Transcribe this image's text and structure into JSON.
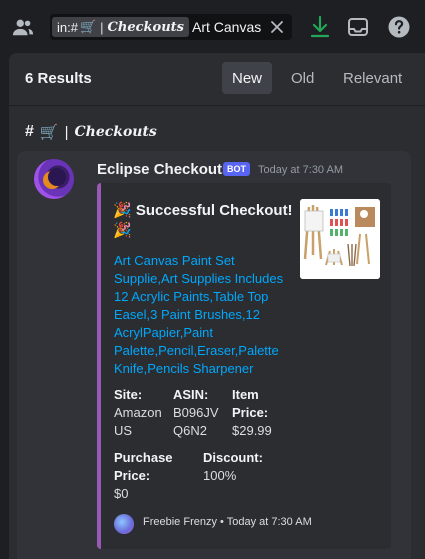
{
  "topbar": {
    "people_icon": "people-icon",
    "search": {
      "chip_prefix": "in:",
      "chip_hash": "#",
      "chip_emoji": "🛒",
      "chip_sep": "|",
      "chip_channel": "𝑪𝒉𝒆𝒄𝒌𝒐𝒖𝒕𝒔",
      "query": "Art Canvas",
      "clear_icon": "close-icon"
    },
    "download_icon": "download-icon",
    "inbox_icon": "inbox-icon",
    "help_icon": "help-icon",
    "download_color": "#23a55a"
  },
  "results": {
    "count": "6 Results",
    "sort_tabs": [
      {
        "label": "New",
        "active": true
      },
      {
        "label": "Old",
        "active": false
      },
      {
        "label": "Relevant",
        "active": false
      }
    ]
  },
  "channel": {
    "hash": "#",
    "emoji": "🛒",
    "sep": "|",
    "name": "𝑪𝒉𝒆𝒄𝒌𝒐𝒖𝒕𝒔"
  },
  "message": {
    "author": "Eclipse Checkouts",
    "bot_tag": "BOT",
    "timestamp": "Today at 7:30 AM",
    "embed": {
      "accent_color": "#9b59b6",
      "title": "🎉 Successful Checkout! 🎉",
      "description": "Art Canvas Paint Set Supplie,Art Supplies Includes 12 Acrylic Paints,Table Top Easel,3 Paint Brushes,12 AcrylPapier,Paint Palette,Pencil,Eraser,Palette Knife,Pencils Sharpener",
      "fields": {
        "site_name": "Site:",
        "site_value": "Amazon US",
        "asin_name": "ASIN:",
        "asin_value": "B096JV Q6N2",
        "price_name": "Item Price:",
        "price_value": "$29.99",
        "purchase_name": "Purchase Price:",
        "purchase_value": "$0",
        "discount_name": "Discount:",
        "discount_value": "100%"
      },
      "footer": {
        "text": "Freebie Frenzy • Today at 7:30 AM"
      }
    }
  }
}
